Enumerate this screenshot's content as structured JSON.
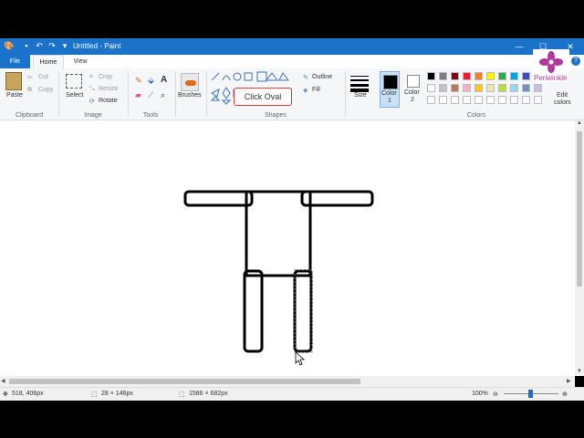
{
  "window": {
    "title": "Untitled - Paint"
  },
  "tabs": {
    "file": "File",
    "home": "Home",
    "view": "View"
  },
  "clipboard": {
    "paste": "Paste",
    "cut": "Cut",
    "copy": "Copy",
    "label": "Clipboard"
  },
  "image": {
    "select": "Select",
    "crop": "Crop",
    "resize": "Resize",
    "rotate": "Rotate",
    "label": "Image"
  },
  "tools": {
    "label": "Tools"
  },
  "brushes": {
    "label": "Brushes"
  },
  "shapes": {
    "outline": "Outline",
    "fill": "Fill",
    "label": "Shapes"
  },
  "size": {
    "label": "Size"
  },
  "color1": {
    "label1": "Color",
    "label2": "1"
  },
  "color2": {
    "label1": "Color",
    "label2": "2"
  },
  "colors": {
    "label": "Colors",
    "edit1": "Edit",
    "edit2": "colors",
    "palette_row1": [
      "#000000",
      "#7f7f7f",
      "#880015",
      "#ed1c24",
      "#ff7f27",
      "#fff200",
      "#22b14c",
      "#00a2e8",
      "#3f48cc",
      "#a349a4"
    ],
    "palette_row2": [
      "#ffffff",
      "#c3c3c3",
      "#b97a57",
      "#ffaec9",
      "#ffc90e",
      "#efe4b0",
      "#b5e61d",
      "#99d9ea",
      "#7092be",
      "#c8bfe7"
    ]
  },
  "tooltip": {
    "text": "Click Oval"
  },
  "logo": {
    "text": "Periwinkle"
  },
  "status": {
    "cursor_pos": "518, 406px",
    "selection_size": "28 × 146px",
    "canvas_size": "1586 × 682px",
    "zoom": "100%"
  }
}
